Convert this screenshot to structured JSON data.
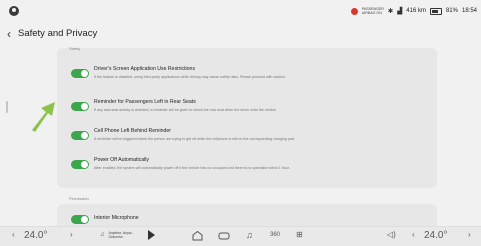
{
  "status": {
    "airbag_line1": "PASSENGER",
    "airbag_line2": "AIRBAG ON",
    "range": "416 km",
    "battery": "81%",
    "clock": "18:54"
  },
  "header": {
    "title": "Safety and Privacy"
  },
  "panel": {
    "section_label": "Safety",
    "items": [
      {
        "title": "Driver's Screen Application Use Restrictions",
        "desc": "If the feature is disabled, using third-party applications while driving may cause safety risks. Please proceed with caution."
      },
      {
        "title": "Reminder for Passengers Left in Rear Seats",
        "desc": "If any rear-seat activity is detected, a reminder will be given to check the rear seat when the driver exits the vehicle."
      },
      {
        "title": "Cell Phone Left Behind Reminder",
        "desc": "A reminder will be triggered when the person are trying to get off while the cellphone is still on the corresponding charging pad."
      },
      {
        "title": "Power Off Automatically",
        "desc": "After enabled, the system will automatically power off if the vehicle has no occupant and there is no operation within 1 hour."
      }
    ]
  },
  "panel2": {
    "section_label": "Permission",
    "items": [
      {
        "title": "Interior Microphone"
      }
    ]
  },
  "dock": {
    "left_temp": "24.0°",
    "right_temp": "24.0°",
    "music_line1": "Anytime, Anyw...",
    "music_line2": "Grancino"
  }
}
